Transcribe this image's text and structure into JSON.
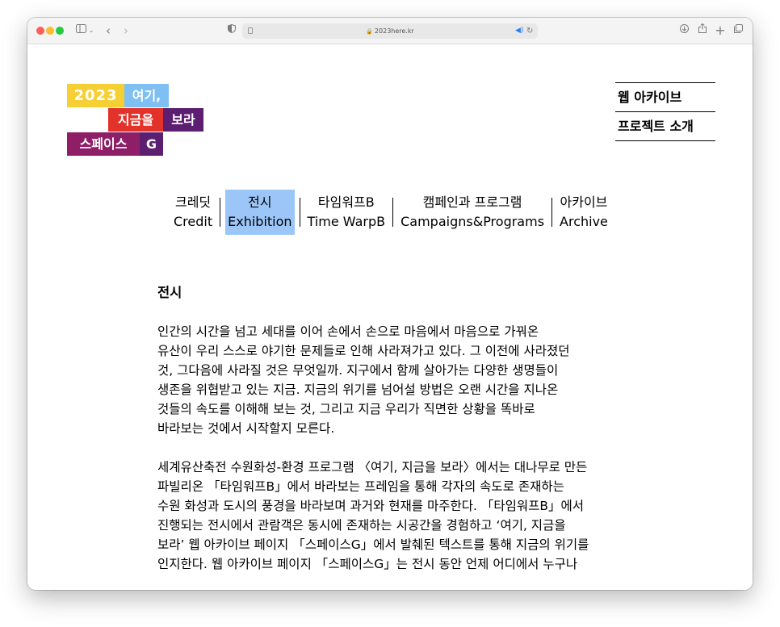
{
  "browser": {
    "url": "2023here.kr"
  },
  "logo": {
    "row1": [
      "2023",
      "여기,"
    ],
    "row2": [
      "지금을",
      "보라"
    ],
    "row3": [
      "스페이스",
      "G"
    ]
  },
  "side_links": [
    {
      "label": "웹 아카이브"
    },
    {
      "label": "프로젝트 소개"
    }
  ],
  "nav": [
    {
      "ko": "크레딧",
      "en": "Credit",
      "active": false
    },
    {
      "ko": "전시",
      "en": "Exhibition",
      "active": true
    },
    {
      "ko": "타임워프B",
      "en": "Time WarpB",
      "active": false
    },
    {
      "ko": "캠페인과 프로그램",
      "en": "Campaigns&Programs",
      "active": false
    },
    {
      "ko": "아카이브",
      "en": "Archive",
      "active": false
    }
  ],
  "content": {
    "title": "전시",
    "paragraphs": [
      [
        "인간의 시간을 넘고 세대를 이어 손에서 손으로 마음에서 마음으로 가꿔온",
        "유산이 우리 스스로 야기한 문제들로 인해 사라져가고 있다. 그 이전에 사라졌던",
        "것, 그다음에 사라질 것은 무엇일까. 지구에서 함께 살아가는 다양한 생명들이",
        "생존을 위협받고 있는 지금. 지금의 위기를 넘어설 방법은 오랜 시간을 지나온",
        "것들의 속도를 이해해 보는 것, 그리고 지금 우리가 직면한 상황을 똑바로",
        "바라보는 것에서 시작할지 모른다."
      ],
      [
        "세계유산축전 수원화성-환경 프로그램 〈여기, 지금을 보라〉에서는 대나무로 만든",
        "파빌리온 「타임워프B」에서 바라보는 프레임을 통해 각자의 속도로 존재하는",
        "수원 화성과 도시의 풍경을 바라보며 과거와 현재를 마주한다. 「타임워프B」에서",
        "진행되는 전시에서 관람객은 동시에 존재하는 시공간을 경험하고 ‘여기, 지금을",
        "보라’ 웹 아카이브 페이지 「스페이스G」에서 발췌된 텍스트를 통해 지금의 위기를",
        "인지한다. 웹 아카이브 페이지 「스페이스G」는 전시 동안 언제 어디에서 누구나"
      ]
    ]
  }
}
